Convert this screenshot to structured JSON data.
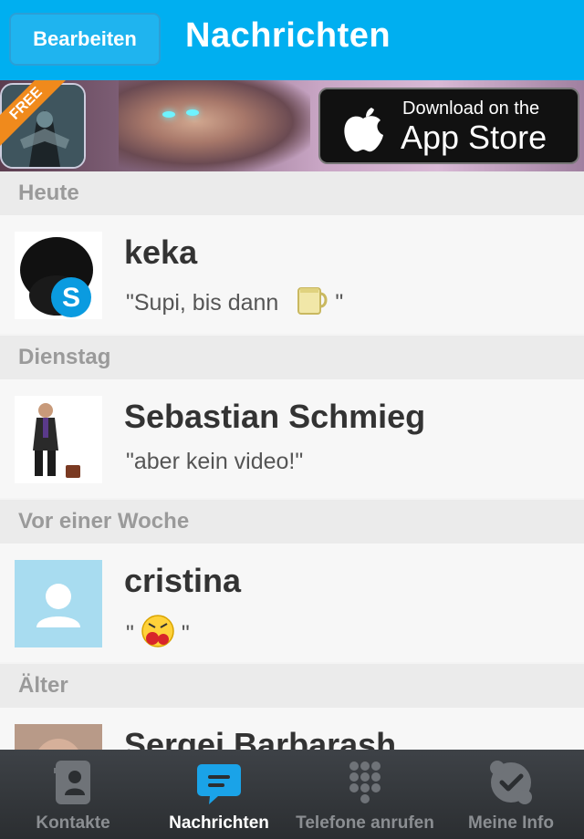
{
  "header": {
    "edit_label": "Bearbeiten",
    "title": "Nachrichten"
  },
  "banner": {
    "ribbon": "FREE",
    "appstore_line1": "Download on the",
    "appstore_line2": "App Store"
  },
  "sections": [
    {
      "label": "Heute"
    },
    {
      "label": "Dienstag"
    },
    {
      "label": "Vor einer Woche"
    },
    {
      "label": "Älter"
    }
  ],
  "conversations": [
    {
      "name": "keka",
      "message_prefix": "\"Supi, bis dann",
      "message_suffix": "\"",
      "emoji": "coffee-mug"
    },
    {
      "name": "Sebastian Schmieg",
      "message": "\"aber kein video!\""
    },
    {
      "name": "cristina",
      "message_prefix": "\"",
      "message_suffix": "\"",
      "emoji": "angry-boxing-face"
    },
    {
      "name": "Sergei Barbarash"
    }
  ],
  "tabs": [
    {
      "label": "Kontakte",
      "icon": "contacts-icon"
    },
    {
      "label": "Nachrichten",
      "icon": "chat-bubble-icon"
    },
    {
      "label": "Telefone anrufen",
      "icon": "dialpad-icon"
    },
    {
      "label": "Meine Info",
      "icon": "skype-check-icon"
    }
  ],
  "colors": {
    "accent": "#00aff0",
    "section_bg": "#ebebeb",
    "row_bg": "#f7f7f7",
    "tabbar_bg": "#2b2e31"
  }
}
